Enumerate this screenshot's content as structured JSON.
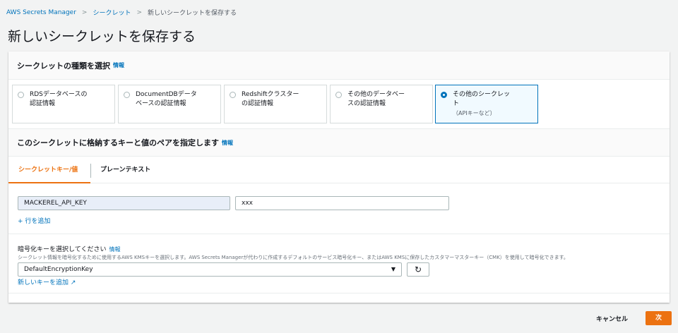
{
  "breadcrumb": [
    "AWS Secrets Manager",
    "シークレット",
    "新しいシークレットを保存する"
  ],
  "title": "新しいシークレットを保存する",
  "type_section": {
    "title": "シークレットの種類を選択",
    "info": "情報",
    "options": [
      {
        "label": "RDSデータベースの",
        "label2": "認証情報",
        "sub": "",
        "selected": false
      },
      {
        "label": "DocumentDBデータ",
        "label2": "ベースの認証情報",
        "sub": "",
        "selected": false
      },
      {
        "label": "Redshiftクラスター",
        "label2": "の認証情報",
        "sub": "",
        "selected": false
      },
      {
        "label": "その他のデータベー",
        "label2": "スの認証情報",
        "sub": "",
        "selected": false
      },
      {
        "label": "その他のシークレッ",
        "label2": "ト",
        "sub": "（APIキーなど）",
        "selected": true
      }
    ]
  },
  "kv_section": {
    "title": "このシークレットに格納するキーと値のペアを指定します",
    "info": "情報",
    "tabs": [
      "シークレットキー/値",
      "プレーンテキスト"
    ],
    "key": "MACKEREL_API_KEY",
    "value": "xxx",
    "add_row": "+ 行を追加"
  },
  "encryption": {
    "label": "暗号化キーを選択してください",
    "info": "情報",
    "description": "シークレット情報を暗号化するために使用するAWS KMSキーを選択します。AWS Secrets Managerが代わりに作成するデフォルトのサービス暗号化キー、またはAWS KMSに保存したカスタマーマスターキー（CMK）を使用して暗号化できます。",
    "selected": "DefaultEncryptionKey",
    "add_key": "新しいキーを追加"
  },
  "footer": {
    "cancel": "キャンセル",
    "next": "次"
  },
  "colors": {
    "accent": "#ec7211",
    "link": "#0073bb"
  }
}
